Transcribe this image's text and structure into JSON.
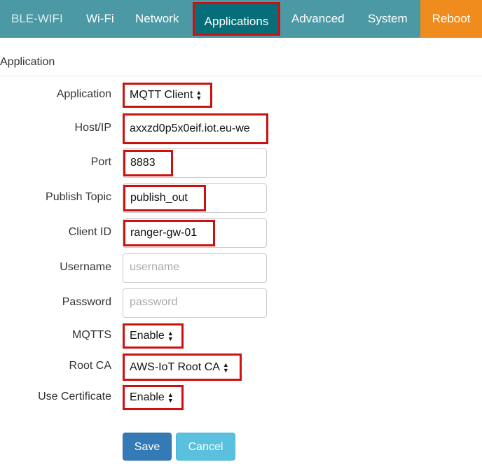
{
  "navbar": {
    "brand": "BLE-WIFI",
    "items": [
      {
        "label": "Wi-Fi"
      },
      {
        "label": "Network"
      },
      {
        "label": "Applications"
      },
      {
        "label": "Advanced"
      },
      {
        "label": "System"
      },
      {
        "label": "Reboot"
      }
    ],
    "colors": {
      "bar": "#4a99a5",
      "active": "#066e79",
      "reboot": "#f08c1e",
      "highlight": "#cc1111"
    }
  },
  "section": {
    "title": "Application"
  },
  "form": {
    "application": {
      "label": "Application",
      "value": "MQTT Client"
    },
    "host": {
      "label": "Host/IP",
      "value": "axxzd0p5x0eif.iot.eu-we"
    },
    "port": {
      "label": "Port",
      "value": "8883"
    },
    "publish_topic": {
      "label": "Publish Topic",
      "value": "publish_out"
    },
    "client_id": {
      "label": "Client ID",
      "value": "ranger-gw-01"
    },
    "username": {
      "label": "Username",
      "placeholder": "username"
    },
    "password": {
      "label": "Password",
      "placeholder": "password"
    },
    "mqtts": {
      "label": "MQTTS",
      "value": "Enable"
    },
    "root_ca": {
      "label": "Root CA",
      "value": "AWS-IoT Root CA"
    },
    "use_certificate": {
      "label": "Use Certificate",
      "value": "Enable"
    }
  },
  "buttons": {
    "save": "Save",
    "cancel": "Cancel"
  }
}
